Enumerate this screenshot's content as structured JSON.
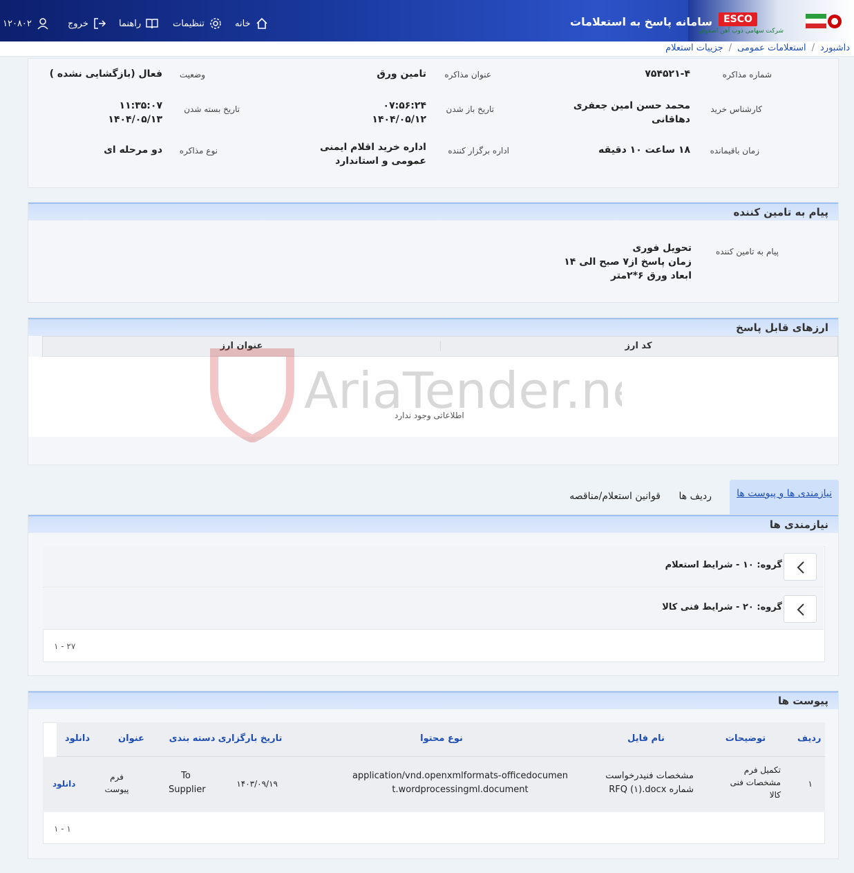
{
  "header": {
    "app_title": "سامانه پاسخ به استعلامات",
    "brand": "ESCO",
    "brand_sub": "شرکت سهامی ذوب آهن اصفهان",
    "nav_home": "خانه",
    "nav_settings": "تنظیمات",
    "nav_guide": "راهنما",
    "nav_logout": "خروج",
    "user_id": "۱۲۰۸۰۲"
  },
  "breadcrumb": [
    "داشبورد",
    "استعلامات عمومی",
    "جزییات استعلام"
  ],
  "details": {
    "negotiation_no_label": "شماره مذاکره",
    "negotiation_no": "۷۵۴۵۲۱-۴",
    "title_label": "عنوان مذاکره",
    "title": "تامین ورق",
    "status_label": "وضعیت",
    "status": "فعال (بازگشایی نشده )",
    "buyer_label": "کارشناس خرید",
    "buyer": "محمد حسن امین جعفری دهاقانی",
    "open_date_label": "تاریخ باز شدن",
    "open_time": "۰۷:۵۶:۲۴",
    "open_date": "۱۴۰۴/۰۵/۱۲",
    "close_date_label": "تاریخ بسته شدن",
    "close_time": "۱۱:۳۵:۰۷",
    "close_date": "۱۴۰۴/۰۵/۱۳",
    "remaining_label": "زمان باقیمانده",
    "remaining": "۱۸ ساعت ۱۰ دقیقه",
    "organizer_label": "اداره برگزار کننده",
    "organizer": "اداره خرید اقلام ایمنی عمومی و استاندارد",
    "type_label": "نوع مذاکره",
    "type": "دو مرحله ای"
  },
  "supplier_message": {
    "heading": "پیام به تامین کننده",
    "label": "پیام به تامین کننده",
    "lines": [
      "تحویل فوری",
      "زمان پاسخ از۷ صبح الی ۱۴",
      "ابعاد ورق ۶*۲متر"
    ]
  },
  "currencies": {
    "heading": "ارزهای قابل پاسخ",
    "col_code": "کد ارز",
    "col_title": "عنوان ارز",
    "empty": "اطلاعاتی وجود ندارد"
  },
  "watermark": "AriaTender.neT",
  "tabs": [
    "نیازمندی ها و پیوست ها",
    "ردیف ها",
    "قوانین استعلام/مناقصه"
  ],
  "requirements": {
    "heading": "نیازمندی ها",
    "groups": [
      "گروه: ۱۰ - شرایط استعلام",
      "گروه: ۲۰ - شرایط فنی کالا"
    ],
    "pager": "۱ - ۲۷"
  },
  "attachments": {
    "heading": "پیوست ها",
    "columns": [
      "ردیف",
      "توضیحات",
      "نام فایل",
      "نوع محتوا",
      "تاریخ بارگزاری",
      "دسته بندی",
      "عنوان",
      "دانلود"
    ],
    "rows": [
      {
        "row": "۱",
        "desc": "تکمیل فرم مشخصات فنی کالا",
        "file": "مشخصات فنیدرخواست شماره RFQ (۱).docx",
        "content_type": "application/vnd.openxmlformats-officedocument.wordprocessingml.document",
        "date": "۱۴۰۳/۰۹/۱۹",
        "category": "To Supplier",
        "title": "فرم پیوست",
        "download": "دانلود"
      }
    ],
    "pager": "۱ - ۱"
  }
}
